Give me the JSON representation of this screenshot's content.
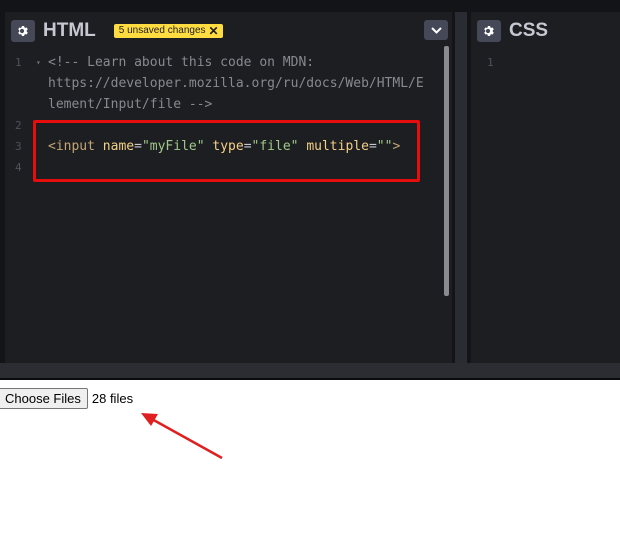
{
  "html_pane": {
    "title": "HTML",
    "badge_label": "5 unsaved changes",
    "badge_close": "✕",
    "lines": [
      {
        "num": "1",
        "segments": [
          {
            "cls": "cm",
            "text": "<!-- Learn about this code on MDN:"
          }
        ]
      },
      {
        "num": "",
        "segments": [
          {
            "cls": "cm",
            "text": "https://developer.mozilla.org/ru/docs/Web/HTML/E"
          }
        ]
      },
      {
        "num": "",
        "segments": [
          {
            "cls": "cm",
            "text": "lement/Input/file -->"
          }
        ]
      },
      {
        "num": "2",
        "segments": []
      },
      {
        "num": "3",
        "segments": [
          {
            "cls": "tag",
            "text": "<input"
          },
          {
            "cls": "pun",
            "text": " "
          },
          {
            "cls": "attr",
            "text": "name"
          },
          {
            "cls": "pun",
            "text": "="
          },
          {
            "cls": "str",
            "text": "\"myFile\""
          },
          {
            "cls": "pun",
            "text": " "
          },
          {
            "cls": "attr",
            "text": "type"
          },
          {
            "cls": "pun",
            "text": "="
          },
          {
            "cls": "str",
            "text": "\"file\""
          },
          {
            "cls": "pun",
            "text": " "
          },
          {
            "cls": "attr",
            "text": "multiple"
          },
          {
            "cls": "pun",
            "text": "="
          },
          {
            "cls": "str",
            "text": "\"\""
          },
          {
            "cls": "tag",
            "text": ">"
          }
        ]
      },
      {
        "num": "4",
        "segments": []
      }
    ]
  },
  "css_pane": {
    "title": "CSS",
    "line_numbers": [
      "1"
    ]
  },
  "preview": {
    "button_label": "Choose Files",
    "status_text": "28 files"
  },
  "colors": {
    "badge": "#ffdd40",
    "highlight": "#e60d0d",
    "arrow": "#e02020"
  },
  "icons": {
    "settings": "gear-icon",
    "collapse": "chevron-down-icon",
    "fold": "fold-triangle-icon"
  }
}
